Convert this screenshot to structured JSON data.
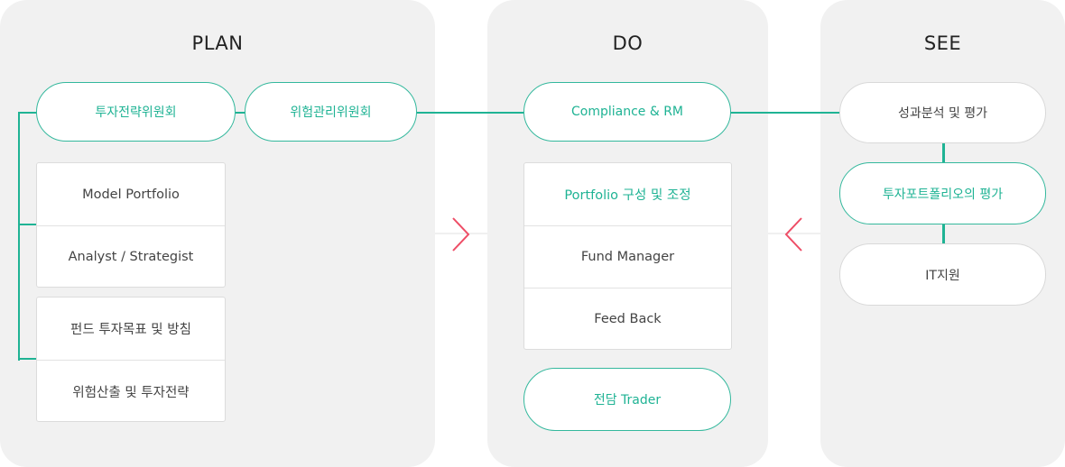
{
  "colors": {
    "accent": "#1fb394",
    "arrow": "#ee4d66",
    "panel_bg": "#f1f1f1",
    "text": "#444444"
  },
  "plan": {
    "title": "PLAN",
    "committees": [
      "투자전략위원회",
      "위험관리위원회"
    ],
    "group1": [
      "Model Portfolio",
      "Analyst / Strategist"
    ],
    "group2": [
      "펀드 투자목표 및 방침",
      "위험산출 및 투자전략"
    ]
  },
  "do": {
    "title": "DO",
    "header_pill": "Compliance & RM",
    "group": [
      "Portfolio 구성 및 조정",
      "Fund Manager",
      "Feed Back"
    ],
    "bottom_pill": "전담 Trader"
  },
  "see": {
    "title": "SEE",
    "items": [
      "성과분석 및 평가",
      "투자포트폴리오의 평가",
      "IT지원"
    ]
  },
  "arrows": {
    "plan_to_do": "chevron-right-icon",
    "see_to_do": "chevron-left-icon"
  }
}
